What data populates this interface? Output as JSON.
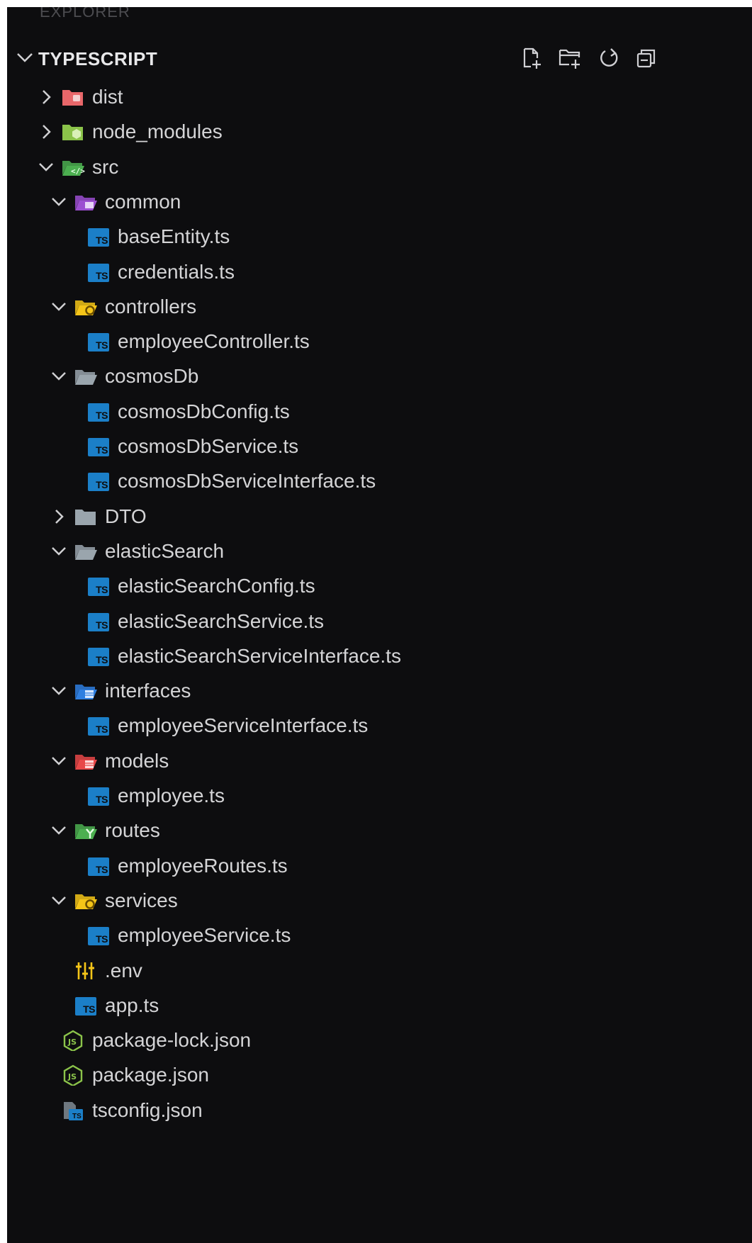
{
  "panel_title": "EXPLORER",
  "section": {
    "title": "TYPESCRIPT",
    "actions": [
      {
        "name": "new-file-icon"
      },
      {
        "name": "new-folder-icon"
      },
      {
        "name": "refresh-icon"
      },
      {
        "name": "collapse-all-icon"
      }
    ]
  },
  "tree": [
    {
      "label": "dist",
      "kind": "folder",
      "expanded": false,
      "depth": 0,
      "icon": "folder-dist-icon",
      "color": "#e8676a"
    },
    {
      "label": "node_modules",
      "kind": "folder",
      "expanded": false,
      "depth": 0,
      "icon": "folder-node-icon",
      "color": "#8bc34a"
    },
    {
      "label": "src",
      "kind": "folder",
      "expanded": true,
      "depth": 0,
      "icon": "folder-src-icon",
      "color": "#4caf50"
    },
    {
      "label": "common",
      "kind": "folder",
      "expanded": true,
      "depth": 1,
      "icon": "folder-common-icon",
      "color": "#9c4fd1"
    },
    {
      "label": "baseEntity.ts",
      "kind": "ts",
      "depth": 2,
      "icon": "typescript-file-icon"
    },
    {
      "label": "credentials.ts",
      "kind": "ts",
      "depth": 2,
      "icon": "typescript-file-icon"
    },
    {
      "label": "controllers",
      "kind": "folder",
      "expanded": true,
      "depth": 1,
      "icon": "folder-controllers-icon",
      "color": "#f5c518"
    },
    {
      "label": "employeeController.ts",
      "kind": "ts",
      "depth": 2,
      "icon": "typescript-file-icon"
    },
    {
      "label": "cosmosDb",
      "kind": "folder",
      "expanded": true,
      "depth": 1,
      "icon": "folder-open-icon",
      "color": "#9aa5ad"
    },
    {
      "label": "cosmosDbConfig.ts",
      "kind": "ts",
      "depth": 2,
      "icon": "typescript-file-icon"
    },
    {
      "label": "cosmosDbService.ts",
      "kind": "ts",
      "depth": 2,
      "icon": "typescript-file-icon"
    },
    {
      "label": "cosmosDbServiceInterface.ts",
      "kind": "ts",
      "depth": 2,
      "icon": "typescript-file-icon"
    },
    {
      "label": "DTO",
      "kind": "folder",
      "expanded": false,
      "depth": 1,
      "icon": "folder-icon",
      "color": "#9aa5ad"
    },
    {
      "label": "elasticSearch",
      "kind": "folder",
      "expanded": true,
      "depth": 1,
      "icon": "folder-open-icon",
      "color": "#9aa5ad"
    },
    {
      "label": "elasticSearchConfig.ts",
      "kind": "ts",
      "depth": 2,
      "icon": "typescript-file-icon"
    },
    {
      "label": "elasticSearchService.ts",
      "kind": "ts",
      "depth": 2,
      "icon": "typescript-file-icon"
    },
    {
      "label": "elasticSearchServiceInterface.ts",
      "kind": "ts",
      "depth": 2,
      "icon": "typescript-file-icon"
    },
    {
      "label": "interfaces",
      "kind": "folder",
      "expanded": true,
      "depth": 1,
      "icon": "folder-interfaces-icon",
      "color": "#2f7fe0"
    },
    {
      "label": "employeeServiceInterface.ts",
      "kind": "ts",
      "depth": 2,
      "icon": "typescript-file-icon"
    },
    {
      "label": "models",
      "kind": "folder",
      "expanded": true,
      "depth": 1,
      "icon": "folder-models-icon",
      "color": "#e84848"
    },
    {
      "label": "employee.ts",
      "kind": "ts",
      "depth": 2,
      "icon": "typescript-file-icon"
    },
    {
      "label": "routes",
      "kind": "folder",
      "expanded": true,
      "depth": 1,
      "icon": "folder-routes-icon",
      "color": "#4caf50"
    },
    {
      "label": "employeeRoutes.ts",
      "kind": "ts",
      "depth": 2,
      "icon": "typescript-file-icon"
    },
    {
      "label": "services",
      "kind": "folder",
      "expanded": true,
      "depth": 1,
      "icon": "folder-services-icon",
      "color": "#f5c518"
    },
    {
      "label": "employeeService.ts",
      "kind": "ts",
      "depth": 2,
      "icon": "typescript-file-icon"
    },
    {
      "label": ".env",
      "kind": "env",
      "depth": 1,
      "icon": "env-settings-icon",
      "color": "#f5c518"
    },
    {
      "label": "app.ts",
      "kind": "ts",
      "depth": 1,
      "icon": "typescript-file-icon"
    },
    {
      "label": "package-lock.json",
      "kind": "node",
      "depth": 0,
      "icon": "nodejs-icon",
      "color": "#8bc34a"
    },
    {
      "label": "package.json",
      "kind": "node",
      "depth": 0,
      "icon": "nodejs-icon",
      "color": "#8bc34a"
    },
    {
      "label": "tsconfig.json",
      "kind": "tsconfig",
      "depth": 0,
      "icon": "tsconfig-icon"
    }
  ],
  "colors": {
    "background": "#0d0d0f",
    "text": "#d4d4d6",
    "typescript": "#1b7fc8"
  }
}
